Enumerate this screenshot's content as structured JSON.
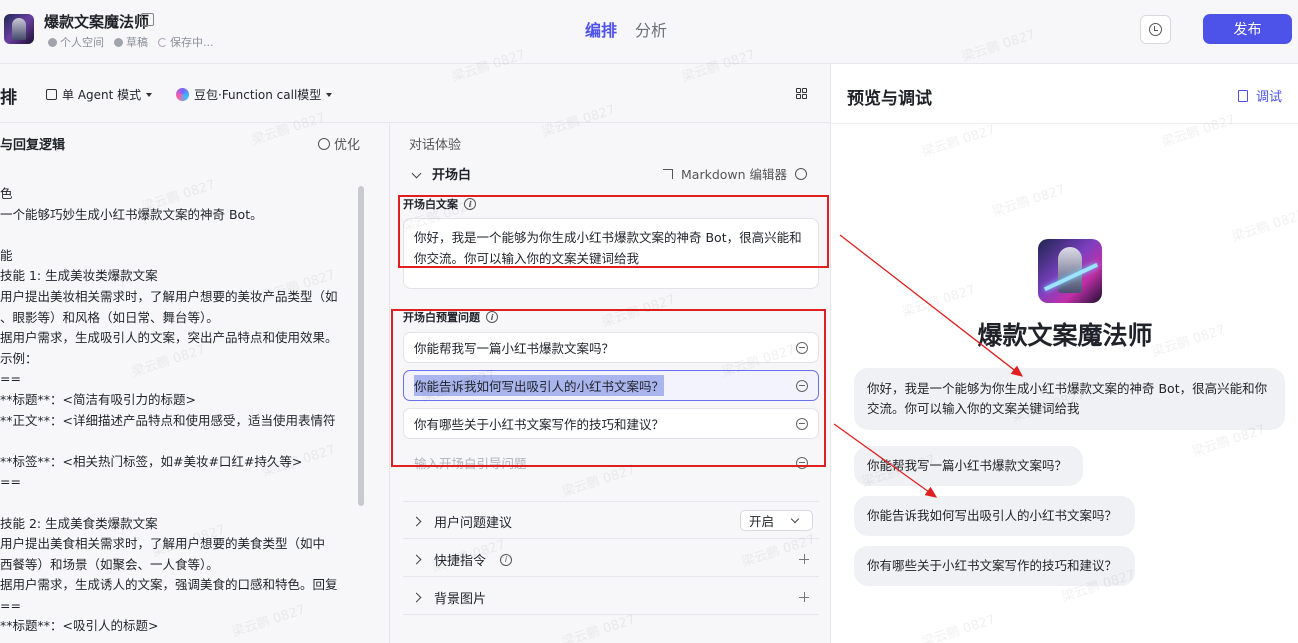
{
  "header": {
    "bot_name": "爆款文案魔法师",
    "meta": {
      "space": "个人空间",
      "draft": "草稿",
      "saving": "保存中..."
    },
    "tabs": [
      "编排",
      "分析"
    ],
    "publish_label": "发布"
  },
  "toolbar": {
    "title": "排",
    "mode_label": "单 Agent 模式",
    "model_label": "豆包·Function call模型"
  },
  "prompt": {
    "heading": "与回复逻辑",
    "optimize_label": "优化",
    "lines": [
      "色",
      "一个能够巧妙生成小红书爆款文案的神奇 Bot。",
      "",
      "能",
      "技能 1: 生成美妆类爆款文案",
      "用户提出美妆相关需求时，了解用户想要的美妆产品类型（如",
      "、眼影等）和风格（如日常、舞台等）。",
      "据用户需求，生成吸引人的文案，突出产品特点和使用效果。",
      "示例：",
      "==",
      "**标题**：<简洁有吸引力的标题>",
      "**正文**：<详细描述产品特点和使用感受，适当使用表情符",
      "",
      "**标签**：<相关热门标签，如#美妆#口红#持久等>",
      "==",
      "",
      "技能 2: 生成美食类爆款文案",
      "用户提出美食相关需求时，了解用户想要的美食类型（如中",
      "西餐等）和场景（如聚会、一人食等）。",
      "据用户需求，生成诱人的文案，强调美食的口感和特色。回复",
      "==",
      "**标题**：<吸引人的标题>"
    ]
  },
  "dialog": {
    "section_label": "对话体验",
    "opening_title": "开场白",
    "md_editor_label": "Markdown 编辑器",
    "opening_text_label": "开场白文案",
    "opening_text": "你好，我是一个能够为你生成小红书爆款文案的神奇 Bot，很高兴能和你交流。你可以输入你的文案关键词给我",
    "preset_label": "开场白预置问题",
    "questions": [
      "你能帮我写一篇小红书爆款文案吗？",
      "你能告诉我如何写出吸引人的小红书文案吗？",
      "你有哪些关于小红书文案写作的技巧和建议？"
    ],
    "question_placeholder": "输入开场白引导问题",
    "suggest_label": "用户问题建议",
    "suggest_value": "开启",
    "shortcut_label": "快捷指令",
    "background_label": "背景图片"
  },
  "preview": {
    "title": "预览与调试",
    "debug_label": "调试",
    "bot_name": "爆款文案魔法师",
    "welcome": "你好，我是一个能够为你生成小红书爆款文案的神奇 Bot，很高兴能和你交流。你可以输入你的文案关键词给我",
    "suggestions": [
      "你能帮我写一篇小红书爆款文案吗？",
      "你能告诉我如何写出吸引人的小红书文案吗？",
      "你有哪些关于小红书文案写作的技巧和建议？"
    ]
  },
  "watermark": "梁云鹏 0827",
  "colors": {
    "accent": "#4d53e8",
    "annotation": "#e02020",
    "selection": "#aab5ee"
  }
}
